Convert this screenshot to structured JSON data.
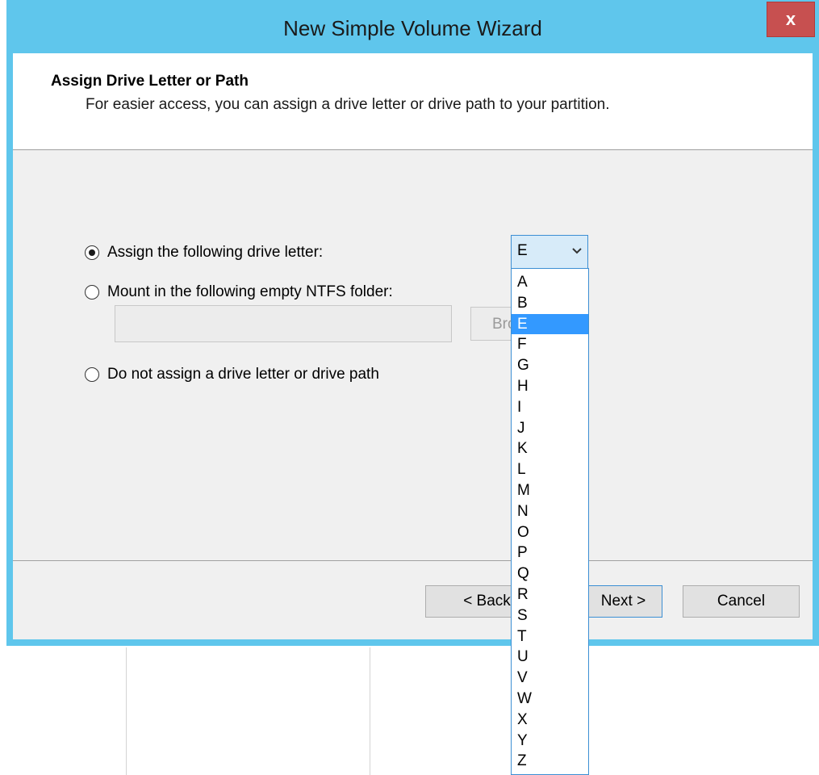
{
  "window": {
    "title": "New Simple Volume Wizard",
    "close_label": "x"
  },
  "header": {
    "title": "Assign Drive Letter or Path",
    "subtitle": "For easier access, you can assign a drive letter or drive path to your partition."
  },
  "options": {
    "assign_letter": "Assign the following drive letter:",
    "mount_folder": "Mount in the following empty NTFS folder:",
    "no_assign": "Do not assign a drive letter or drive path",
    "selected": "assign_letter"
  },
  "folder_input": {
    "value": ""
  },
  "browse_button": {
    "label": "Browse..."
  },
  "drive_letter": {
    "selected": "E",
    "options": [
      "A",
      "B",
      "E",
      "F",
      "G",
      "H",
      "I",
      "J",
      "K",
      "L",
      "M",
      "N",
      "O",
      "P",
      "Q",
      "R",
      "S",
      "T",
      "U",
      "V",
      "W",
      "X",
      "Y",
      "Z"
    ]
  },
  "buttons": {
    "back": "< Back",
    "next": "Next >",
    "cancel": "Cancel"
  },
  "colors": {
    "frame": "#5fc6ec",
    "close": "#c75050",
    "selection": "#3399ff"
  }
}
